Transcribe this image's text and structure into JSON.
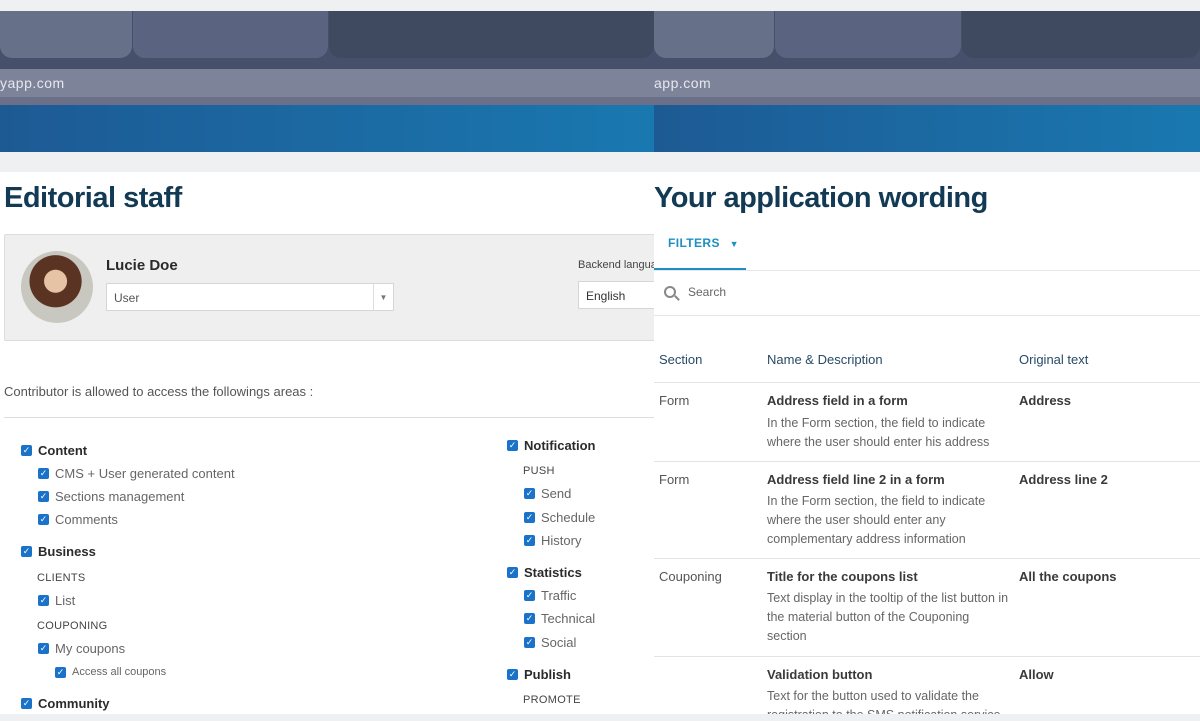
{
  "left": {
    "url": "yapp.com",
    "title": "Editorial staff",
    "user": {
      "name": "Lucie Doe",
      "role": "User",
      "lang_label": "Backend langua",
      "lang_value": "English"
    },
    "access_text": "Contributor is allowed to access the followings areas :",
    "col1": {
      "content": "Content",
      "cms": "CMS + User generated content",
      "sections": "Sections management",
      "comments": "Comments",
      "business": "Business",
      "clients": "CLIENTS",
      "list": "List",
      "couponing": "COUPONING",
      "my_coupons": "My coupons",
      "access_all": "Access all coupons",
      "community": "Community"
    },
    "col2": {
      "notification": "Notification",
      "push": "PUSH",
      "send": "Send",
      "schedule": "Schedule",
      "history": "History",
      "statistics": "Statistics",
      "traffic": "Traffic",
      "technical": "Technical",
      "social": "Social",
      "publish": "Publish",
      "promote": "PROMOTE"
    }
  },
  "right": {
    "url": "app.com",
    "title": "Your application wording",
    "filters": "FILTERS",
    "search_placeholder": "Search",
    "headers": {
      "section": "Section",
      "name": "Name & Description",
      "original": "Original text"
    },
    "rows": [
      {
        "section": "Form",
        "name": "Address field in a form",
        "desc": "In the Form section, the field to indicate where the user should enter his address",
        "original": "Address"
      },
      {
        "section": "Form",
        "name": "Address field line 2 in a form",
        "desc": "In the Form section, the field to indicate where the user should enter any complementary address information",
        "original": "Address line 2"
      },
      {
        "section": "Couponing",
        "name": "Title for the coupons list",
        "desc": "Text display in the tooltip of the list button in the material button of the Couponing section",
        "original": "All the coupons"
      },
      {
        "section": "",
        "name": "Validation button",
        "desc": "Text for the button used to validate the registration to the SMS notification service",
        "original": "Allow"
      }
    ]
  },
  "colors": {
    "accent": "#1d8fc4",
    "checkbox": "#1a73c9",
    "title": "#123a55"
  }
}
